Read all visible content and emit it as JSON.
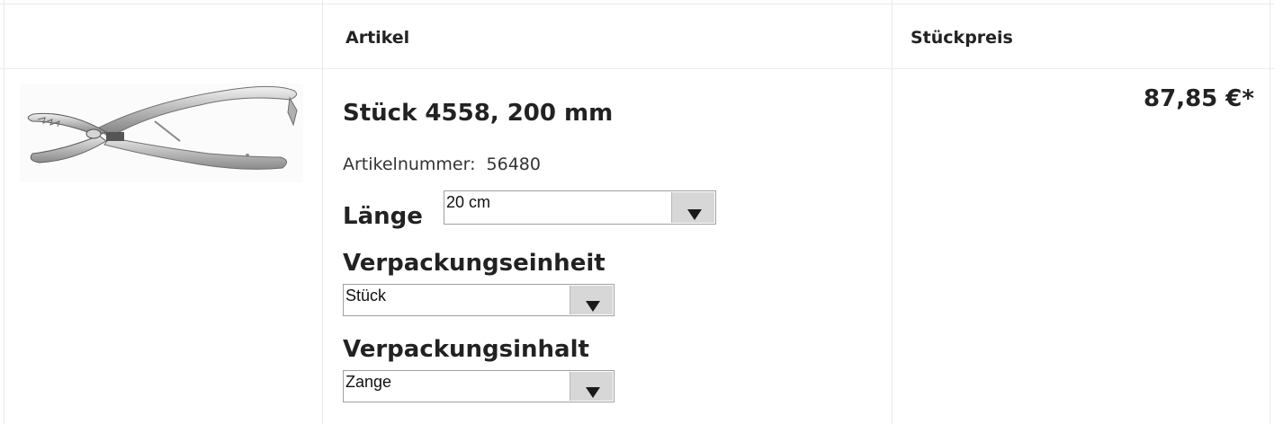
{
  "table": {
    "headers": {
      "artikel": "Artikel",
      "stueckpreis": "Stückpreis"
    }
  },
  "product": {
    "image_icon": "pliers-instrument-icon",
    "title": "Stück 4558, 200 mm",
    "artikelnummer_label": "Artikelnummer:",
    "artikelnummer_value": "56480",
    "options": {
      "laenge": {
        "label": "Länge",
        "selected": "20 cm"
      },
      "verpackungseinheit": {
        "label": "Verpackungseinheit",
        "selected": "Stück"
      },
      "verpackungsinhalt": {
        "label": "Verpackungsinhalt",
        "selected": "Zange"
      }
    },
    "price": "87,85 €*"
  },
  "colors": {
    "border": "#e9e9e9",
    "select_arrow_bg": "#d7d7d7",
    "text": "#222222"
  }
}
